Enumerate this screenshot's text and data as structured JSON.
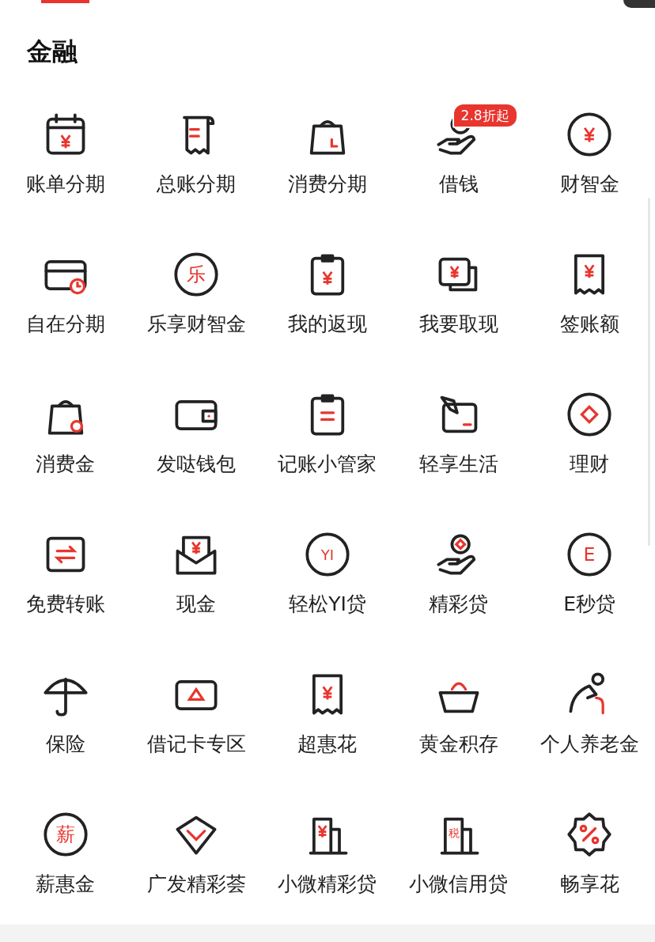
{
  "section": {
    "title": "金融"
  },
  "items": [
    {
      "label": "账单分期"
    },
    {
      "label": "总账分期"
    },
    {
      "label": "消费分期"
    },
    {
      "label": "借钱",
      "badge": "2.8折起"
    },
    {
      "label": "财智金"
    },
    {
      "label": "自在分期"
    },
    {
      "label": "乐享财智金",
      "glyph": "乐"
    },
    {
      "label": "我的返现"
    },
    {
      "label": "我要取现"
    },
    {
      "label": "签账额"
    },
    {
      "label": "消费金"
    },
    {
      "label": "发哒钱包"
    },
    {
      "label": "记账小管家"
    },
    {
      "label": "轻享生活"
    },
    {
      "label": "理财"
    },
    {
      "label": "免费转账"
    },
    {
      "label": "现金"
    },
    {
      "label": "轻松YI贷",
      "glyph": "YI"
    },
    {
      "label": "精彩贷"
    },
    {
      "label": "E秒贷",
      "glyph": "E"
    },
    {
      "label": "保险"
    },
    {
      "label": "借记卡专区"
    },
    {
      "label": "超惠花"
    },
    {
      "label": "黄金积存"
    },
    {
      "label": "个人养老金"
    },
    {
      "label": "薪惠金",
      "glyph": "薪"
    },
    {
      "label": "广发精彩荟"
    },
    {
      "label": "小微精彩贷"
    },
    {
      "label": "小微信用贷",
      "glyph": "税"
    },
    {
      "label": "畅享花"
    }
  ]
}
